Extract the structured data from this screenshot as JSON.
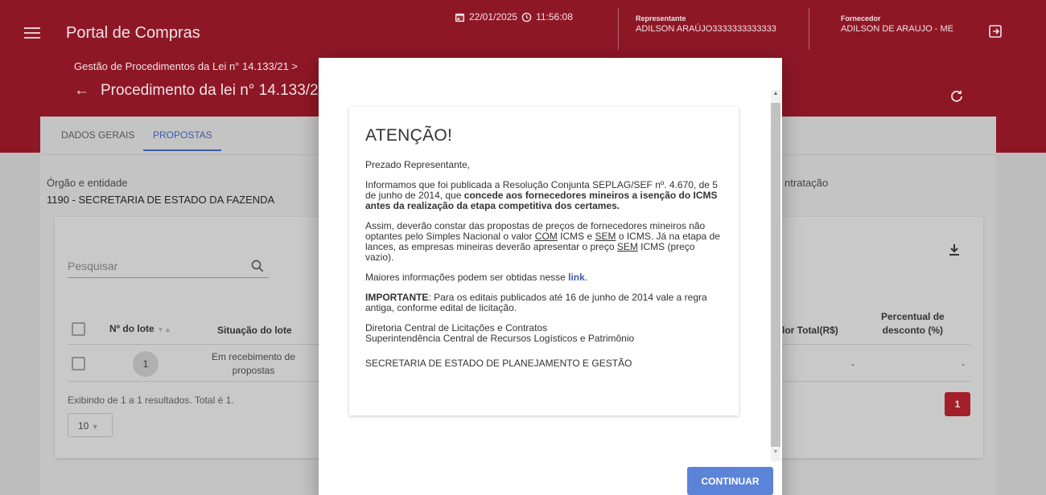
{
  "header": {
    "app_title": "Portal de Compras",
    "datetime": "22/01/2025 ⓘ 11:56:08",
    "date": "22/01/2025",
    "time": "11:56:08",
    "rep_label": "Representante",
    "rep_value": "ADILSON ARAÚJO3333333333333",
    "sup_label": "Fornecedor",
    "sup_value": "ADILSON DE ARAUJO - ME"
  },
  "breadcrumb": "Gestão de Procedimentos da Lei n° 14.133/21 >",
  "page_title": "Procedimento da lei n° 14.133/21",
  "tabs": [
    "DADOS GERAIS",
    "PROPOSTAS"
  ],
  "organization": {
    "label": "Órgão e entidade",
    "value": "1190 - SECRETARIA DE ESTADO DA FAZENDA",
    "contract_label_partial": "ntratação"
  },
  "search": {
    "placeholder": "Pesquisar"
  },
  "table": {
    "headers": {
      "lote": "Nº do lote",
      "situacao": "Situação do lote",
      "valor_total": "lor Total(R$)",
      "percentual_1": "Percentual de",
      "percentual_2": "desconto (%)"
    },
    "rows": [
      {
        "lote": "1",
        "situacao_1": "Em recebimento de",
        "situacao_2": "propostas",
        "valor_total": "-",
        "percentual": "-"
      }
    ],
    "results": "Exibindo de 1 a 1 resultados. Total é 1.",
    "page_size": "10",
    "current_page": "1"
  },
  "modal": {
    "title": "ATENÇÃO!",
    "greeting": "Prezado Representante,",
    "p1_a": "Informamos que foi publicada a Resolução Conjunta SEPLAG/SEF nº. 4.670, de 5 de junho de 2014, que ",
    "p1_b": "concede aos fornecedores mineiros a isenção do ICMS antes da realização da etapa competitiva dos certames.",
    "p2_a": "Assim, deverão constar das propostas de preços de fornecedores mineiros não optantes pelo Simples Nacional o valor ",
    "p2_com": "COM",
    "p2_b": " ICMS e ",
    "p2_sem": "SEM",
    "p2_c": " o ICMS. Já na etapa de lances, as empresas mineiras deverão apresentar o preço ",
    "p2_sem2": "SEM",
    "p2_d": " ICMS (preço vazio).",
    "p3_a": "Maiores informações podem ser obtidas nesse ",
    "p3_link": "link",
    "p3_b": ".",
    "p4_bold": "IMPORTANTE",
    "p4": ": Para os editais publicados até 16 de junho de 2014 vale a regra antiga, conforme edital de licitação.",
    "sign_1": "Diretoria Central de Licitações e Contratos",
    "sign_2": "Superintendência Central de Recursos Logísticos e Patrimônio",
    "footer": "SECRETARIA DE ESTADO DE PLANEJAMENTO E GESTÃO",
    "continue": "CONTINUAR"
  },
  "colors": {
    "brand_red": "#b61e31",
    "accent_blue": "#3d5aa8",
    "button_blue": "#5b84d9",
    "page_btn_red": "#a31f2a"
  }
}
